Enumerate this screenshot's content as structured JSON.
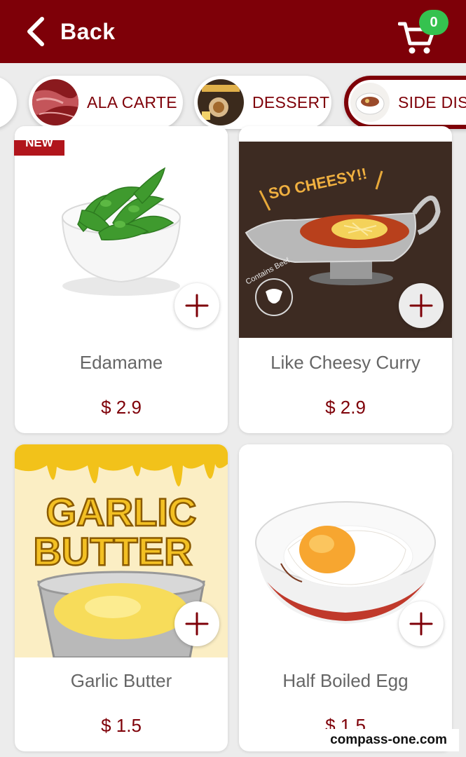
{
  "header": {
    "back_label": "Back",
    "cart_count": "0"
  },
  "categories": [
    {
      "label": "ALA CARTE",
      "active": false
    },
    {
      "label": "DESSERT",
      "active": false
    },
    {
      "label": "SIDE DISH",
      "active": true
    }
  ],
  "products": [
    {
      "name": "Edamame",
      "price": "$ 2.9",
      "badge": "NEW"
    },
    {
      "name": "Like Cheesy Curry",
      "price": "$ 2.9",
      "image_text": "SO CHEESY!!",
      "image_note": "Contains Beef"
    },
    {
      "name": "Garlic Butter",
      "price": "$ 1.5",
      "image_text_1": "GARLIC",
      "image_text_2": "BUTTER"
    },
    {
      "name": "Half Boiled Egg",
      "price": "$ 1.5"
    }
  ],
  "watermark": "compass-one.com",
  "colors": {
    "brand": "#7e0008",
    "cart_badge": "#35c24f",
    "background": "#ececec"
  }
}
